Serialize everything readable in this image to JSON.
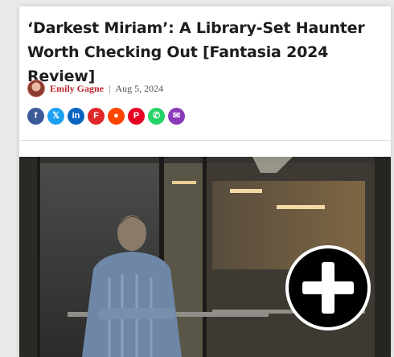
{
  "article": {
    "title": "‘Darkest Miriam’: A Library-Set Haunter Worth Checking Out [Fantasia 2024 Review]",
    "author": "Emily Gagne",
    "separator": "|",
    "date": "Aug 5, 2024"
  },
  "share": [
    {
      "name": "facebook-share-icon",
      "color": "#3b5998",
      "glyph": "f"
    },
    {
      "name": "x-share-icon",
      "color": "#1da1f2",
      "glyph": "𝕏"
    },
    {
      "name": "linkedin-share-icon",
      "color": "#0a66c2",
      "glyph": "in"
    },
    {
      "name": "flipboard-share-icon",
      "color": "#e12828",
      "glyph": "F"
    },
    {
      "name": "reddit-share-icon",
      "color": "#ff4500",
      "glyph": "●"
    },
    {
      "name": "pinterest-share-icon",
      "color": "#e60023",
      "glyph": "P"
    },
    {
      "name": "whatsapp-share-icon",
      "color": "#25d366",
      "glyph": "✆"
    },
    {
      "name": "email-share-icon",
      "color": "#8a3ab9",
      "glyph": "✉"
    }
  ],
  "image": {
    "overlay_icon": "plus-icon"
  }
}
